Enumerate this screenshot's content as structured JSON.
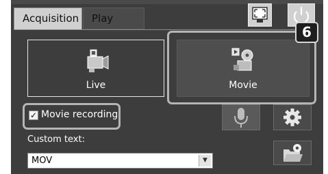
{
  "tabs": [
    {
      "label": "Acquisition",
      "active": true
    },
    {
      "label": "Play",
      "active": false
    }
  ],
  "header_buttons": [
    {
      "icon": "fullscreen-icon"
    },
    {
      "icon": "power-icon"
    }
  ],
  "modes": [
    {
      "label": "Live",
      "icon": "video-camera-icon",
      "selected": false
    },
    {
      "label": "Movie",
      "icon": "film-reel-icon",
      "selected": true
    }
  ],
  "callout_number": "6",
  "movie_recording": {
    "label": "Movie recording",
    "checked": true,
    "check_glyph": "✓"
  },
  "tool_buttons": [
    {
      "icon": "microphone-icon"
    },
    {
      "icon": "gear-icon"
    },
    {
      "icon": "folder-settings-icon"
    }
  ],
  "custom_text": {
    "label": "Custom text:",
    "value": "MOV",
    "arrow": "▼"
  },
  "colors": {
    "panel": "#3d3d3d",
    "tab_active": "#d0d0d0",
    "selected_mode": "#4e4e4e",
    "callout_border": "#b5b5b5"
  }
}
